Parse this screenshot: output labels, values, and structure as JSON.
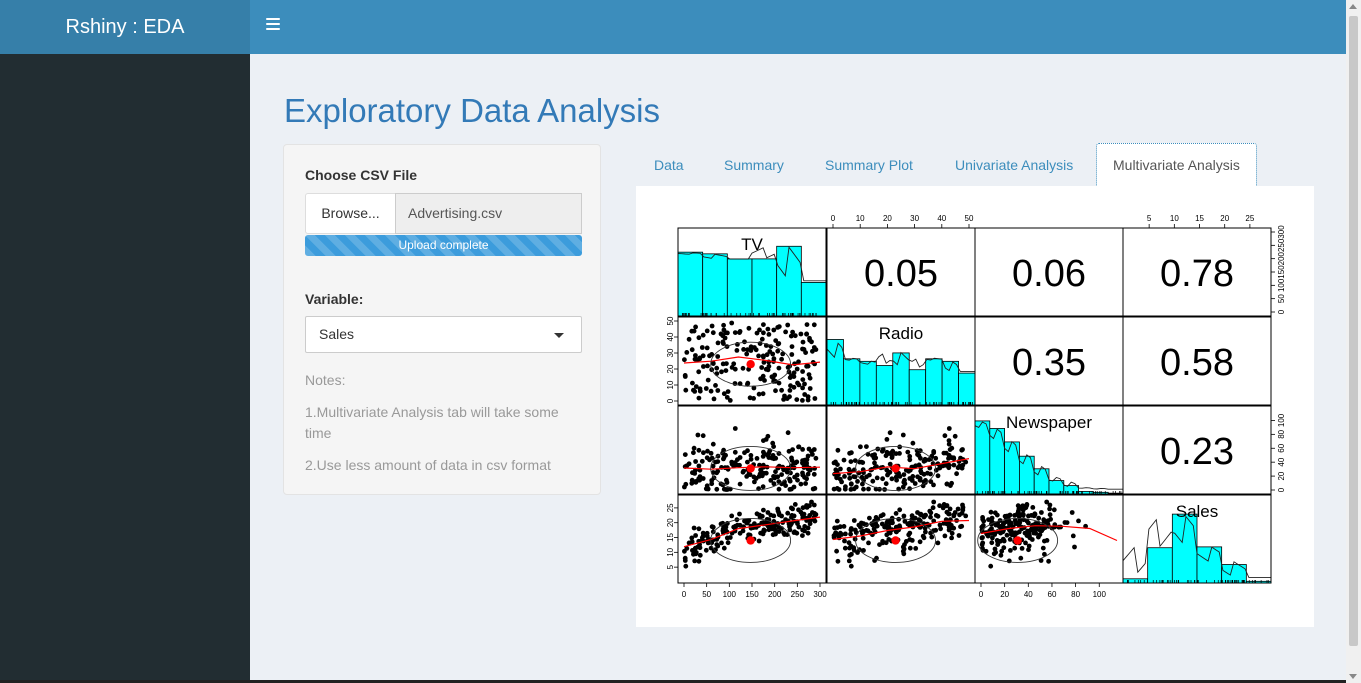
{
  "app": {
    "title": "Rshiny : EDA"
  },
  "header": {
    "menu_icon": "hamburger-icon"
  },
  "page": {
    "title": "Exploratory Data Analysis"
  },
  "sidebar_panel": {
    "file_label": "Choose CSV File",
    "browse_label": "Browse...",
    "file_name": "Advertising.csv",
    "upload_status": "Upload complete",
    "upload_progress": 1.0,
    "variable_label": "Variable:",
    "variable_value": "Sales",
    "notes_title": "Notes:",
    "note1": "1.Multivariate Analysis tab will take some time",
    "note2": "2.Use less amount of data in csv format"
  },
  "tabs": [
    {
      "label": "Data",
      "active": false
    },
    {
      "label": "Summary",
      "active": false
    },
    {
      "label": "Summary Plot",
      "active": false
    },
    {
      "label": "Univariate Analysis",
      "active": false
    },
    {
      "label": "Multivariate Analysis",
      "active": true
    }
  ],
  "colors": {
    "header": "#3c8dbc",
    "logo": "#367fa9",
    "sidebar": "#222d32",
    "histogram": "#00ffff",
    "smooth": "#ff0000"
  },
  "chart_data": {
    "type": "scatter",
    "variables": [
      "TV",
      "Radio",
      "Newspaper",
      "Sales"
    ],
    "correlations": [
      {
        "row": "TV",
        "col": "Radio",
        "value": "0.05"
      },
      {
        "row": "TV",
        "col": "Newspaper",
        "value": "0.06"
      },
      {
        "row": "TV",
        "col": "Sales",
        "value": "0.78"
      },
      {
        "row": "Radio",
        "col": "Newspaper",
        "value": "0.35"
      },
      {
        "row": "Radio",
        "col": "Sales",
        "value": "0.58"
      },
      {
        "row": "Newspaper",
        "col": "Sales",
        "value": "0.23"
      }
    ],
    "axes": {
      "TV": {
        "range": [
          0,
          300
        ],
        "ticks": [
          "0",
          "50",
          "100",
          "150",
          "200",
          "250",
          "300"
        ]
      },
      "Radio": {
        "range": [
          0,
          50
        ],
        "ticks": [
          "0",
          "10",
          "20",
          "30",
          "40",
          "50"
        ]
      },
      "Newspaper": {
        "range": [
          0,
          115
        ],
        "ticks": [
          "0",
          "20",
          "40",
          "60",
          "80",
          "100"
        ]
      },
      "Sales": {
        "range": [
          1,
          28
        ],
        "ticks": [
          "5",
          "10",
          "15",
          "20",
          "25"
        ]
      }
    },
    "histograms": {
      "TV": [
        0.76,
        0.74,
        0.68,
        0.68,
        0.83,
        0.4
      ],
      "Radio": [
        0.78,
        0.55,
        0.52,
        0.47,
        0.62,
        0.42,
        0.55,
        0.52,
        0.38
      ],
      "Newspaper": [
        0.87,
        0.78,
        0.62,
        0.45,
        0.3,
        0.16,
        0.1,
        0.03,
        0.02,
        0.01
      ],
      "Sales": [
        0.05,
        0.42,
        0.82,
        0.43,
        0.22,
        0.02
      ]
    },
    "means": {
      "TV": 147,
      "Radio": 23,
      "Newspaper": 31,
      "Sales": 14
    },
    "scatter_count": 200
  }
}
